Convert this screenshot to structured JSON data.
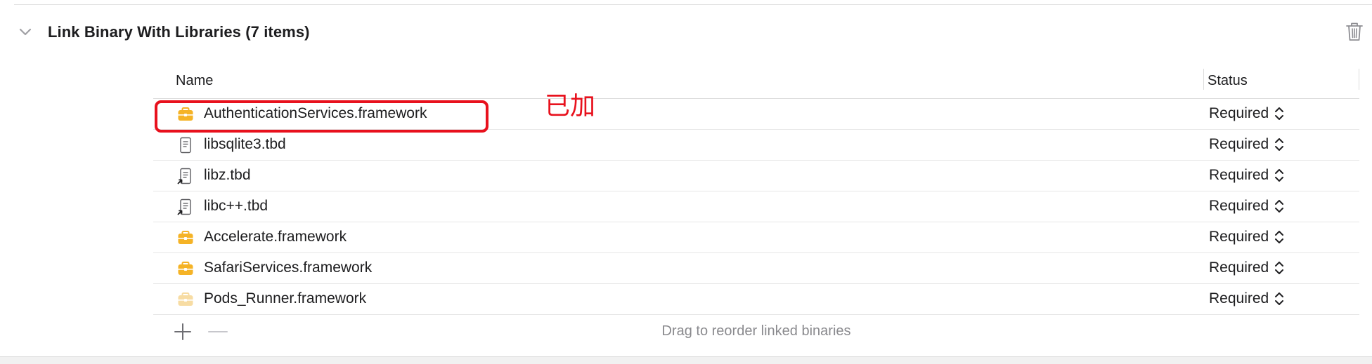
{
  "section": {
    "title": "Link Binary With Libraries (7 items)",
    "expanded": true
  },
  "table": {
    "name_header": "Name",
    "status_header": "Status",
    "rows": [
      {
        "name": "AuthenticationServices.framework",
        "icon": "framework-icon",
        "status": "Required"
      },
      {
        "name": "libsqlite3.tbd",
        "icon": "tbd-file-icon",
        "status": "Required"
      },
      {
        "name": "libz.tbd",
        "icon": "tbd-alias-icon",
        "status": "Required"
      },
      {
        "name": "libc++.tbd",
        "icon": "tbd-alias-icon",
        "status": "Required"
      },
      {
        "name": "Accelerate.framework",
        "icon": "framework-icon",
        "status": "Required"
      },
      {
        "name": "SafariServices.framework",
        "icon": "framework-icon",
        "status": "Required"
      },
      {
        "name": "Pods_Runner.framework",
        "icon": "framework-faded-icon",
        "status": "Required"
      }
    ]
  },
  "footer": {
    "hint": "Drag to reorder linked binaries"
  },
  "annotation": {
    "text": "已加",
    "color": "#e8111d"
  },
  "colors": {
    "framework": "#f5b326",
    "framework_faded": "#f7dca3",
    "annotation": "#e8111d"
  }
}
